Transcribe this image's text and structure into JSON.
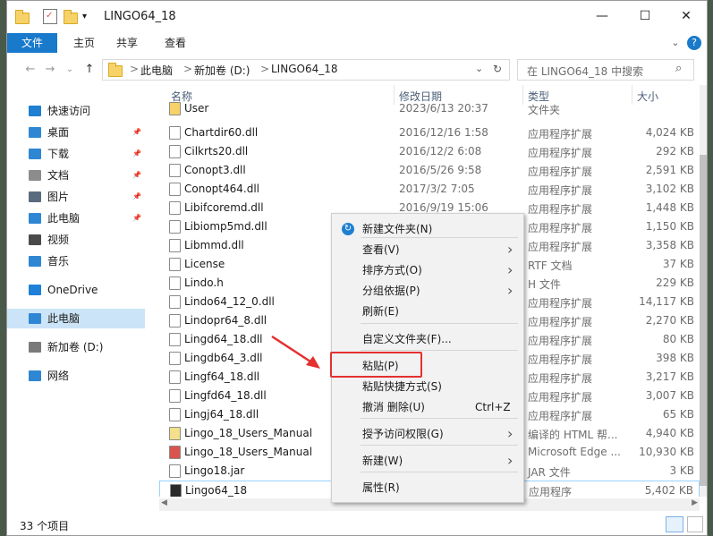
{
  "window": {
    "title": "LINGO64_18"
  },
  "titlebar": {
    "minimize": "—",
    "maximize": "☐",
    "close": "✕"
  },
  "ribbon": {
    "tabs": [
      "文件",
      "主页",
      "共享",
      "查看"
    ],
    "help": "?"
  },
  "nav": {
    "back": "←",
    "forward": "→",
    "dropdown": "⌄",
    "up": "↑",
    "refresh": "↻"
  },
  "address": {
    "crumbs": [
      "此电脑",
      "新加卷 (D:)",
      "LINGO64_18"
    ],
    "separator": ">"
  },
  "search": {
    "placeholder": "在 LINGO64_18 中搜索"
  },
  "sidebar": {
    "items": [
      {
        "label": "快速访问",
        "icon": "star-icon",
        "color": "#1f7fd1",
        "pinned": false
      },
      {
        "label": "桌面",
        "icon": "desktop-icon",
        "color": "#2f87d3",
        "pinned": true
      },
      {
        "label": "下载",
        "icon": "download-icon",
        "color": "#2f87d3",
        "pinned": true
      },
      {
        "label": "文档",
        "icon": "document-icon",
        "color": "#8c8c8c",
        "pinned": true
      },
      {
        "label": "图片",
        "icon": "picture-icon",
        "color": "#5b6b7e",
        "pinned": true
      },
      {
        "label": "此电脑",
        "icon": "computer-icon",
        "color": "#2f87d3",
        "pinned": true
      },
      {
        "label": "视频",
        "icon": "video-icon",
        "color": "#4a4a4a",
        "pinned": false
      },
      {
        "label": "音乐",
        "icon": "music-icon",
        "color": "#2f87d3",
        "pinned": false
      },
      {
        "label": "OneDrive",
        "icon": "cloud-icon",
        "color": "#1e80d8",
        "pinned": false
      },
      {
        "label": "此电脑",
        "icon": "computer-icon",
        "color": "#2f87d3",
        "pinned": false,
        "selected": true
      },
      {
        "label": "新加卷 (D:)",
        "icon": "drive-icon",
        "color": "#7a7a7a",
        "pinned": false
      },
      {
        "label": "网络",
        "icon": "network-icon",
        "color": "#2f87d3",
        "pinned": false
      }
    ],
    "pin_glyph": "📌"
  },
  "columns": [
    "名称",
    "修改日期",
    "类型",
    "大小"
  ],
  "files": [
    {
      "name": "User",
      "date": "2023/6/13 20:37",
      "type": "文件夹",
      "size": "",
      "icon": "folder-icon"
    },
    {
      "name": "Chartdir60.dll",
      "date": "2016/12/16 1:58",
      "type": "应用程序扩展",
      "size": "4,024 KB",
      "icon": "dll-icon"
    },
    {
      "name": "Cilkrts20.dll",
      "date": "2016/12/2 6:08",
      "type": "应用程序扩展",
      "size": "292 KB",
      "icon": "dll-icon"
    },
    {
      "name": "Conopt3.dll",
      "date": "2016/5/26 9:58",
      "type": "应用程序扩展",
      "size": "2,591 KB",
      "icon": "dll-icon"
    },
    {
      "name": "Conopt464.dll",
      "date": "2017/3/2 7:05",
      "type": "应用程序扩展",
      "size": "3,102 KB",
      "icon": "dll-icon"
    },
    {
      "name": "Libifcoremd.dll",
      "date": "2016/9/19 15:06",
      "type": "应用程序扩展",
      "size": "1,448 KB",
      "icon": "dll-icon"
    },
    {
      "name": "Libiomp5md.dll",
      "date": "",
      "type": "应用程序扩展",
      "size": "1,150 KB",
      "icon": "dll-icon"
    },
    {
      "name": "Libmmd.dll",
      "date": "",
      "type": "应用程序扩展",
      "size": "3,358 KB",
      "icon": "dll-icon"
    },
    {
      "name": "License",
      "date": "",
      "type": "RTF 文档",
      "size": "37 KB",
      "icon": "doc-icon"
    },
    {
      "name": "Lindo.h",
      "date": "",
      "type": "H 文件",
      "size": "229 KB",
      "icon": "file-icon"
    },
    {
      "name": "Lindo64_12_0.dll",
      "date": "",
      "type": "应用程序扩展",
      "size": "14,117 KB",
      "icon": "dll-icon"
    },
    {
      "name": "Lindopr64_8.dll",
      "date": "",
      "type": "应用程序扩展",
      "size": "2,270 KB",
      "icon": "dll-icon"
    },
    {
      "name": "Lingd64_18.dll",
      "date": "",
      "type": "应用程序扩展",
      "size": "80 KB",
      "icon": "dll-icon"
    },
    {
      "name": "Lingdb64_3.dll",
      "date": "",
      "type": "应用程序扩展",
      "size": "398 KB",
      "icon": "dll-icon"
    },
    {
      "name": "Lingf64_18.dll",
      "date": "",
      "type": "应用程序扩展",
      "size": "3,217 KB",
      "icon": "dll-icon"
    },
    {
      "name": "Lingfd64_18.dll",
      "date": "",
      "type": "应用程序扩展",
      "size": "3,007 KB",
      "icon": "dll-icon"
    },
    {
      "name": "Lingj64_18.dll",
      "date": "",
      "type": "应用程序扩展",
      "size": "65 KB",
      "icon": "dll-icon"
    },
    {
      "name": "Lingo_18_Users_Manual",
      "date": "",
      "type": "编译的 HTML 帮...",
      "size": "4,940 KB",
      "icon": "help-icon"
    },
    {
      "name": "Lingo_18_Users_Manual",
      "date": "",
      "type": "Microsoft Edge ...",
      "size": "10,930 KB",
      "icon": "pdf-icon"
    },
    {
      "name": "Lingo18.jar",
      "date": "",
      "type": "JAR 文件",
      "size": "3 KB",
      "icon": "file-icon"
    },
    {
      "name": "Lingo64_18",
      "date": "",
      "type": "应用程序",
      "size": "5,402 KB",
      "icon": "app-icon",
      "selected": true
    }
  ],
  "status": {
    "count": "33 个项目"
  },
  "context_menu": {
    "items": [
      {
        "label": "新建文件夹(N)",
        "kind": "item",
        "icon": "new-folder-icon"
      },
      {
        "kind": "sep"
      },
      {
        "label": "查看(V)",
        "kind": "submenu"
      },
      {
        "label": "排序方式(O)",
        "kind": "submenu"
      },
      {
        "label": "分组依据(P)",
        "kind": "submenu"
      },
      {
        "label": "刷新(E)",
        "kind": "item"
      },
      {
        "kind": "sep"
      },
      {
        "label": "自定义文件夹(F)...",
        "kind": "item"
      },
      {
        "kind": "sep"
      },
      {
        "label": "粘贴(P)",
        "kind": "item",
        "highlight": true
      },
      {
        "label": "粘贴快捷方式(S)",
        "kind": "item"
      },
      {
        "label": "撤消 删除(U)",
        "kind": "item",
        "shortcut": "Ctrl+Z"
      },
      {
        "kind": "sep"
      },
      {
        "label": "授予访问权限(G)",
        "kind": "submenu"
      },
      {
        "kind": "sep"
      },
      {
        "label": "新建(W)",
        "kind": "submenu"
      },
      {
        "kind": "sep"
      },
      {
        "label": "属性(R)",
        "kind": "item"
      }
    ],
    "arrow": "›"
  },
  "colors": {
    "accent": "#1979ca",
    "selection": "#cce4f7",
    "annotation": "#e53030"
  }
}
